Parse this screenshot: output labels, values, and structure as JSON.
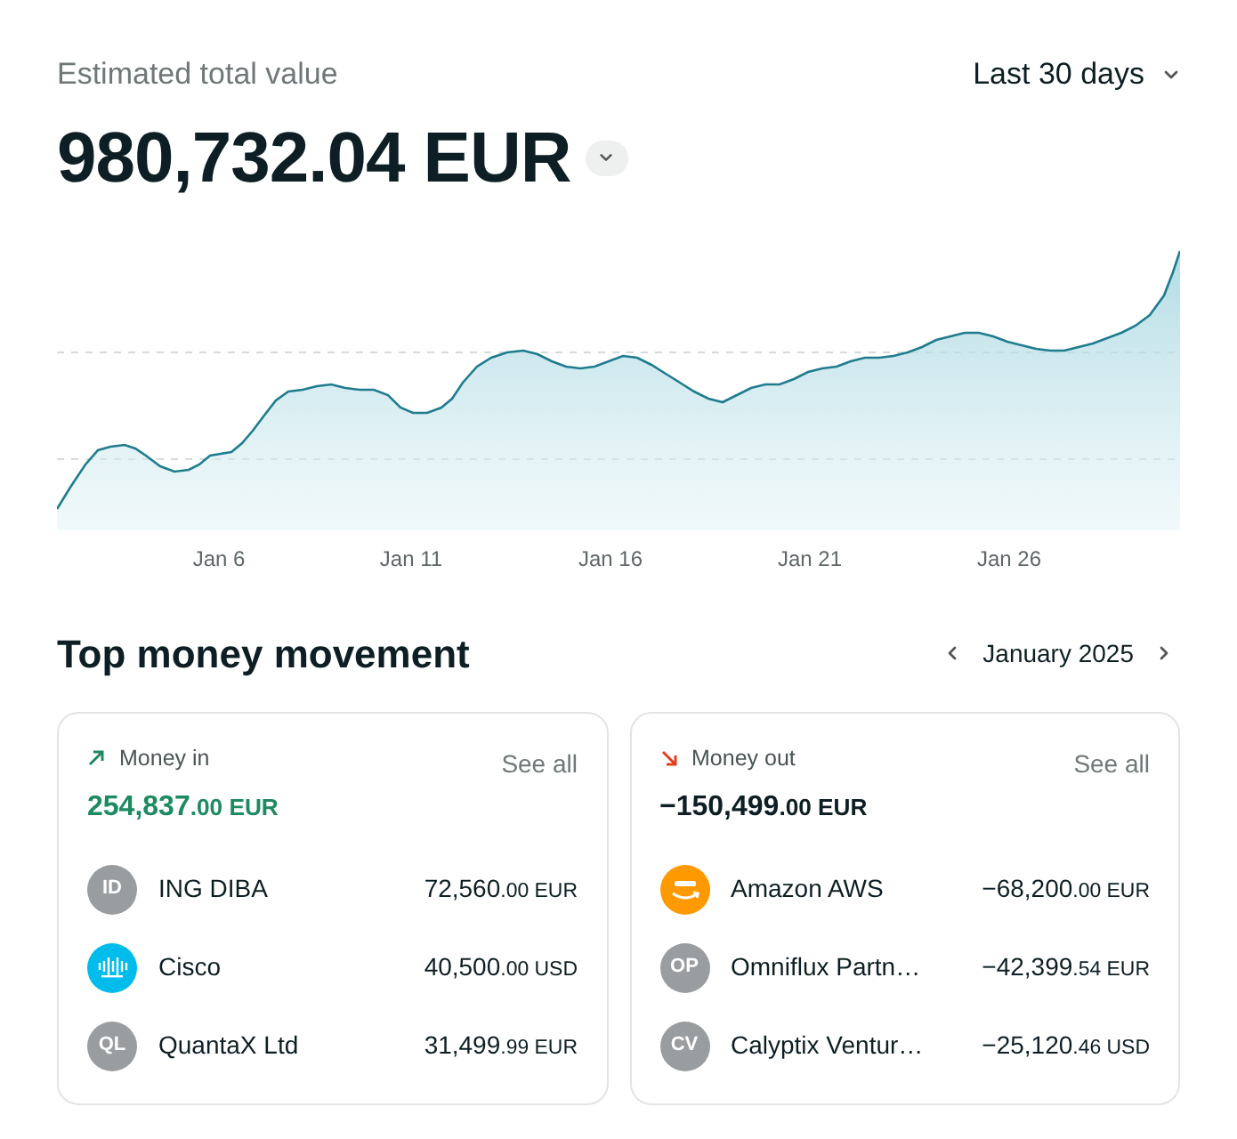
{
  "header": {
    "label": "Estimated total value",
    "period": "Last 30 days"
  },
  "total": {
    "value": "980,732.04 EUR"
  },
  "chart": {
    "x_labels": [
      "Jan 6",
      "Jan 11",
      "Jan 16",
      "Jan 21",
      "Jan 26"
    ]
  },
  "section": {
    "title": "Top money movement",
    "month": "January 2025"
  },
  "cards": [
    {
      "kind": "in",
      "label": "Money in",
      "link": "See all",
      "total": "254,837",
      "total_fraction": ".00 EUR",
      "rows": [
        {
          "avatar": {
            "kind": "initials",
            "text": "ID"
          },
          "name": "ING DIBA",
          "amount": "72,560",
          "fraction": ".00 EUR"
        },
        {
          "avatar": {
            "kind": "bars",
            "color": "#00bceb"
          },
          "name": "Cisco",
          "amount": "40,500",
          "fraction": ".00 USD"
        },
        {
          "avatar": {
            "kind": "initials",
            "text": "QL"
          },
          "name": "QuantaX Ltd",
          "amount": "31,499",
          "fraction": ".99 EUR"
        }
      ]
    },
    {
      "kind": "out",
      "label": "Money out",
      "link": "See all",
      "total": "−150,499",
      "total_fraction": ".00 EUR",
      "rows": [
        {
          "avatar": {
            "kind": "smile",
            "color": "#ff9900"
          },
          "name": "Amazon AWS",
          "amount": "−68,200",
          "fraction": ".00 EUR"
        },
        {
          "avatar": {
            "kind": "initials",
            "text": "OP"
          },
          "name": "Omniflux Partn…",
          "amount": "−42,399",
          "fraction": ".54 EUR"
        },
        {
          "avatar": {
            "kind": "initials",
            "text": "CV"
          },
          "name": "Calyptix Ventur…",
          "amount": "−25,120",
          "fraction": ".46 USD"
        }
      ]
    }
  ]
}
